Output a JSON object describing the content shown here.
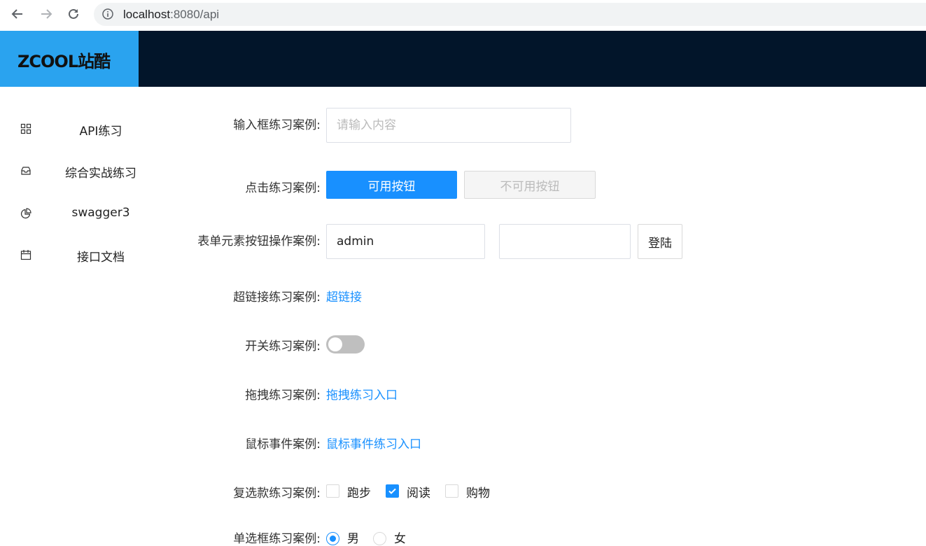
{
  "browser": {
    "url_host": "localhost",
    "url_rest": ":8080/api"
  },
  "header": {
    "logo_text": "ZCOOL站酷"
  },
  "sidebar": {
    "items": [
      {
        "label": "API练习",
        "icon": "grid-icon"
      },
      {
        "label": "综合实战练习",
        "icon": "inbox-icon"
      },
      {
        "label": "swagger3",
        "icon": "pie-chart-icon"
      },
      {
        "label": "接口文档",
        "icon": "calendar-icon"
      }
    ]
  },
  "form": {
    "input_label": "输入框练习案例:",
    "input_placeholder": "请输入内容",
    "click_label": "点击练习案例:",
    "enabled_button": "可用按钮",
    "disabled_button": "不可用按钮",
    "form_label": "表单元素按钮操作案例:",
    "username_value": "admin",
    "password_value": "",
    "login_button": "登陆",
    "link_label": "超链接练习案例:",
    "link_text": "超链接",
    "switch_label": "开关练习案例:",
    "switch_on": false,
    "drag_label": "拖拽练习案例:",
    "drag_link": "拖拽练习入口",
    "mouse_label": "鼠标事件案例:",
    "mouse_link": "鼠标事件练习入口",
    "checkbox_label": "复选款练习案例:",
    "checkboxes": [
      {
        "label": "跑步",
        "checked": false
      },
      {
        "label": "阅读",
        "checked": true
      },
      {
        "label": "购物",
        "checked": false
      }
    ],
    "radio_label": "单选框练习案例:",
    "radios": [
      {
        "label": "男",
        "checked": true
      },
      {
        "label": "女",
        "checked": false
      }
    ]
  }
}
